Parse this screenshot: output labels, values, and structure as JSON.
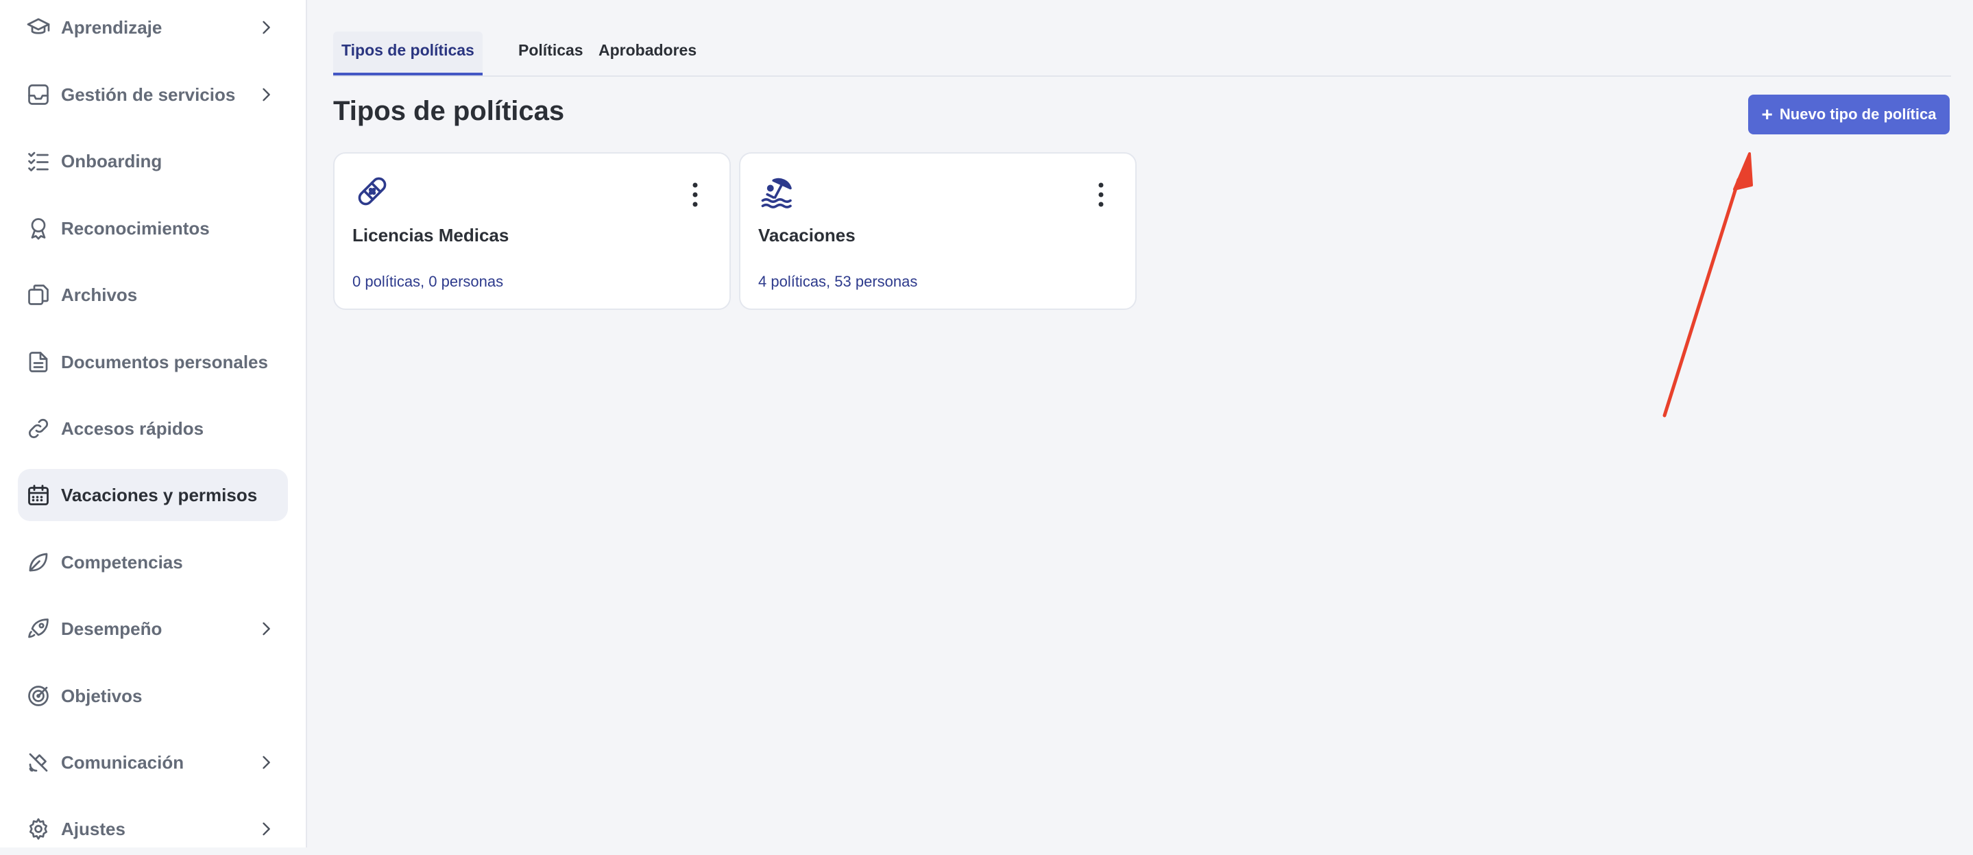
{
  "sidebar": {
    "items": [
      {
        "label": "Aprendizaje",
        "icon": "graduation-cap-icon",
        "has_submenu": true
      },
      {
        "label": "Gestión de servicios",
        "icon": "inbox-icon",
        "has_submenu": true
      },
      {
        "label": "Onboarding",
        "icon": "checklist-icon",
        "has_submenu": false
      },
      {
        "label": "Reconocimientos",
        "icon": "award-ribbon-icon",
        "has_submenu": false
      },
      {
        "label": "Archivos",
        "icon": "files-icon",
        "has_submenu": false
      },
      {
        "label": "Documentos personales",
        "icon": "document-icon",
        "has_submenu": false
      },
      {
        "label": "Accesos rápidos",
        "icon": "link-icon",
        "has_submenu": false
      },
      {
        "label": "Vacaciones y permisos",
        "icon": "calendar-icon",
        "has_submenu": false,
        "active": true
      },
      {
        "label": "Competencias",
        "icon": "leaf-icon",
        "has_submenu": false
      },
      {
        "label": "Desempeño",
        "icon": "rocket-icon",
        "has_submenu": true
      },
      {
        "label": "Objetivos",
        "icon": "target-icon",
        "has_submenu": false
      },
      {
        "label": "Comunicación",
        "icon": "satellite-icon",
        "has_submenu": true
      },
      {
        "label": "Ajustes",
        "icon": "gear-icon",
        "has_submenu": true
      }
    ]
  },
  "tabs": [
    {
      "label": "Tipos de políticas",
      "active": true
    },
    {
      "label": "Políticas",
      "active": false
    },
    {
      "label": "Aprobadores",
      "active": false
    }
  ],
  "page": {
    "title": "Tipos de políticas",
    "new_button": {
      "plus": "+",
      "label": "Nuevo tipo de política"
    }
  },
  "cards": [
    {
      "title": "Licencias Medicas",
      "meta": "0 políticas, 0 personas",
      "icon": "bandage-icon"
    },
    {
      "title": "Vacaciones",
      "meta": "4 políticas, 53 personas",
      "icon": "beach-umbrella-icon"
    }
  ],
  "colors": {
    "accent": "#5468d4",
    "link_text": "#2d3a8c",
    "annotation_arrow": "#e8412c"
  }
}
